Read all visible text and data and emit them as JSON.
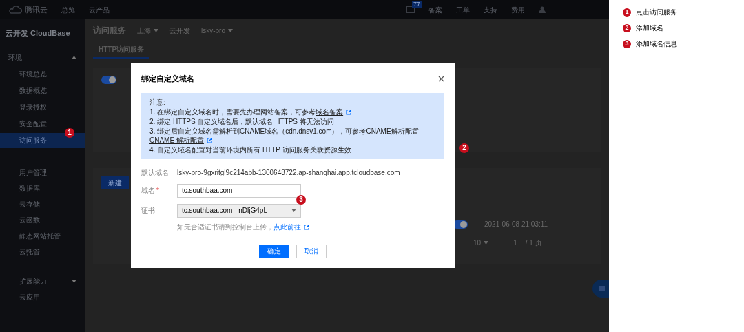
{
  "topbar": {
    "logo": "腾讯云",
    "nav": [
      "总览",
      "云产品"
    ],
    "right": [
      "备案",
      "工单",
      "支持",
      "费用"
    ],
    "message_count": "77"
  },
  "sidebar": {
    "title": "云开发 CloudBase",
    "group": "环境",
    "expanded": true,
    "items": [
      {
        "label": "环境总览",
        "selected": false
      },
      {
        "label": "数据概览",
        "selected": false
      },
      {
        "label": "登录授权",
        "selected": false
      },
      {
        "label": "安全配置",
        "selected": false
      },
      {
        "label": "访问服务",
        "selected": true,
        "marker": "1"
      }
    ],
    "sections": [
      {
        "label": "用户管理"
      },
      {
        "label": "数据库"
      },
      {
        "label": "云存储"
      },
      {
        "label": "云函数"
      },
      {
        "label": "静态网站托管"
      },
      {
        "label": "云托管"
      }
    ],
    "bottom": [
      {
        "label": "扩展能力",
        "expanded": false
      },
      {
        "label": "云应用"
      }
    ]
  },
  "page": {
    "title": "访问服务",
    "region": "上海",
    "env_label": "云开发",
    "env": "lsky-pro",
    "tabs": [
      {
        "label": "HTTP访问服务",
        "selected": true
      }
    ],
    "https_toggle_on": true,
    "new_button": "新建",
    "row": {
      "toggle_on": true,
      "time": "2021-06-08 21:03:11"
    },
    "pagination": {
      "page_size": "10",
      "page": "1",
      "total": "/ 1 页"
    }
  },
  "dialog": {
    "title": "绑定自定义域名",
    "marker": "2",
    "notice": {
      "heading": "注意:",
      "lines": [
        {
          "text": "1. 在绑定自定义域名时，需要先办理网站备案，可参考",
          "link": "域名备案"
        },
        {
          "text": "2. 绑定 HTTPS 自定义域名后，默认域名 HTTPS 将无法访问"
        },
        {
          "text": "3. 绑定后自定义域名需解析到CNAME域名（cdn.dnsv1.com），可参考CNAME解析配置",
          "link": "CNAME 解析配置"
        },
        {
          "text": "4. 自定义域名配置对当前环境内所有 HTTP 访问服务关联资源生效"
        }
      ]
    },
    "default_domain": {
      "label": "默认域名",
      "value": "lsky-pro-9gxritgl9c214abb-1300648722.ap-shanghai.app.tcloudbase.com"
    },
    "domain": {
      "label": "域名",
      "required_mark": "*",
      "value": "tc.southbaa.com",
      "marker": "3"
    },
    "certificate": {
      "label": "证书",
      "value": "tc.southbaa.com - nDljG4pL",
      "hint": "如无合适证书请到控制台上传，",
      "hint_link": "点此前往"
    },
    "buttons": [
      {
        "label": "确定",
        "kind": "primary"
      },
      {
        "label": "取消",
        "kind": "secondary"
      }
    ]
  },
  "annotations": [
    {
      "number": "1",
      "text": "点击访问服务"
    },
    {
      "number": "2",
      "text": "添加域名"
    },
    {
      "number": "3",
      "text": "添加域名信息"
    }
  ]
}
